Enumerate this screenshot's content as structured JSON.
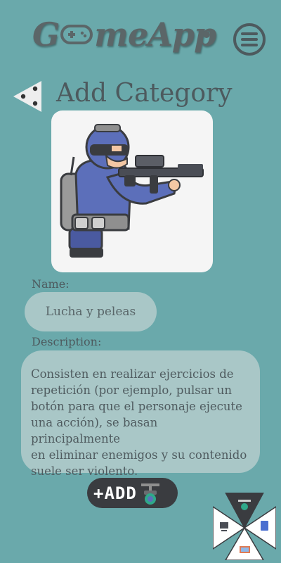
{
  "header": {
    "logo_prefix": "G",
    "logo_suffix": "meApp",
    "menu_icon": "hamburger-circle-icon"
  },
  "page": {
    "title": "Add Category",
    "back_icon": "back-arrow-icon",
    "image_alt": "soldier-with-rifle-illustration"
  },
  "form": {
    "name_label": "Name:",
    "name_value": "Lucha y peleas",
    "description_label": "Description:",
    "description_value": "Consisten en realizar ejercicios de\nrepetición (por ejemplo, pulsar un\nbotón para que el personaje ejecute\nuna acción), se basan principalmente\nen eliminar enemigos y su contenido\n suele ser violento.",
    "add_label": "+ADD"
  },
  "radial_menu": {
    "items": [
      "drone-icon",
      "computer-icon",
      "document-icon",
      "monitor-icon"
    ]
  },
  "colors": {
    "background": "#6aa9ab",
    "field_bg": "#a9c7c7",
    "text": "#4d5a5e",
    "button_bg": "#3a3c40"
  }
}
